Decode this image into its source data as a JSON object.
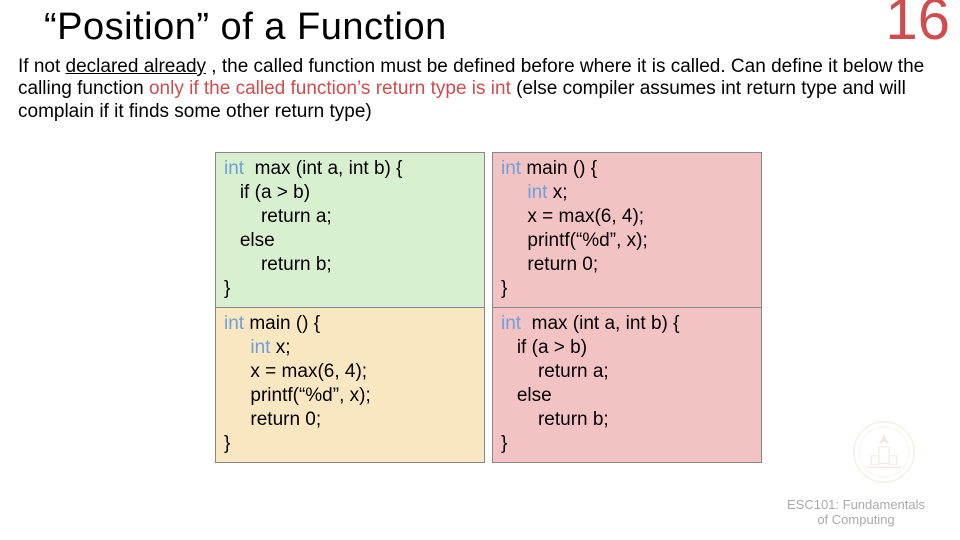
{
  "title": "“Position” of a Function",
  "slide_number": "16",
  "body": {
    "seg1": "If not ",
    "seg2_underlined": "declared already",
    "seg3": ", the called function must be defined before where it is called. Can define it below the calling function ",
    "seg4_accent": "only if the called function’s return type is int",
    "seg5": " (else compiler assumes int return type and will complain if it finds some other return type)"
  },
  "code": {
    "max_def": {
      "l1a": "int",
      "l1b": "  max (int a, int b) {",
      "l2": "   if (a > b)",
      "l3": "       return a;",
      "l4": "   else",
      "l5": "       return b;",
      "l6": "}"
    },
    "main_def": {
      "l1a": "int",
      "l1b": " main () {",
      "l2a": "     int",
      "l2b": " x;",
      "l3": "     x = max(6, 4);",
      "l4": "     printf(“%d”, x);",
      "l5": "     return 0;",
      "l6": "}"
    }
  },
  "footer": {
    "line1": "ESC101: Fundamentals",
    "line2": "of Computing"
  }
}
